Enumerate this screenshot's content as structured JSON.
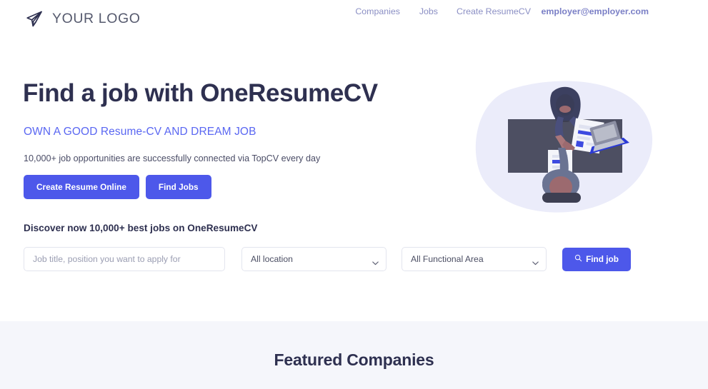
{
  "theme": {
    "accent": "#4d58ea",
    "accent_soft": "#5a67f2",
    "nav_link": "#8b8fc4",
    "nav_email": "#7a7fc6",
    "heading": "#2e3050",
    "body_text": "#4a4c66",
    "placeholder": "#9a9db2",
    "border": "#e3e5ee",
    "section_bg": "#f5f6fb",
    "blob": "#ebecfa",
    "desk": "#4d4f62"
  },
  "header": {
    "logo_icon": "paper-plane-icon",
    "logo_text": "YOUR LOGO",
    "nav": [
      {
        "label": "Companies"
      },
      {
        "label": "Jobs"
      },
      {
        "label": "Create ResumeCV"
      }
    ],
    "account_email": "employer@employer.com"
  },
  "hero": {
    "title": "Find a job with OneResumeCV",
    "subtitle": "OWN A GOOD Resume-CV AND DREAM JOB",
    "description": "10,000+ job opportunities are successfully connected via TopCV every day",
    "buttons": [
      {
        "label": "Create Resume Online"
      },
      {
        "label": "Find Jobs"
      }
    ],
    "discover_heading": "Discover now 10,000+ best jobs on OneResumeCV",
    "illustration_name": "handshake-desk-illustration"
  },
  "search": {
    "keyword_placeholder": "Job title, position you want to apply for",
    "keyword_value": "",
    "location": {
      "selected": "All location",
      "options": [
        "All location"
      ]
    },
    "functional_area": {
      "selected": "All Functional Area",
      "options": [
        "All Functional Area"
      ]
    },
    "submit_label": "Find job",
    "submit_icon": "search-icon"
  },
  "featured": {
    "title": "Featured Companies"
  }
}
